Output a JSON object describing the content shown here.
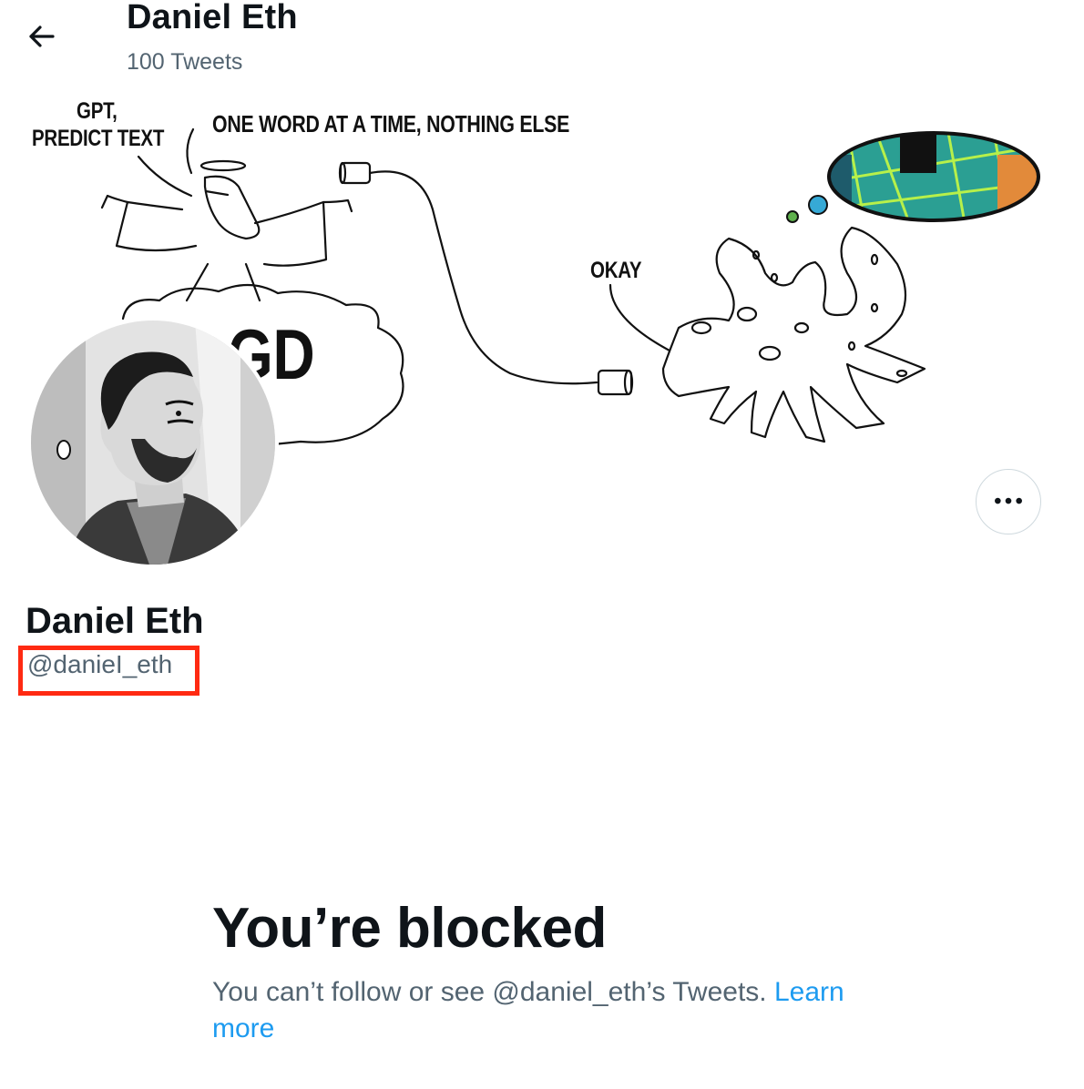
{
  "header": {
    "title": "Daniel Eth",
    "tweet_count": "100 Tweets"
  },
  "banner": {
    "text_gpt": "GPT,",
    "text_predict": "PREDICT TEXT",
    "text_oneword": "ONE WORD AT A TIME, NOTHING ELSE",
    "text_okay": "OKAY",
    "text_cloud": "GD"
  },
  "profile": {
    "name": "Daniel Eth",
    "handle": "@danieI_eth"
  },
  "blocked": {
    "title": "You’re blocked",
    "message": "You can’t follow or see @daniel_eth’s Tweets.",
    "learn_more": "Learn more"
  },
  "colors": {
    "text_primary": "#0f1419",
    "text_secondary": "#536471",
    "link": "#1d9bf0",
    "highlight_box": "#ff2a12"
  },
  "icons": {
    "back": "arrow-left-icon",
    "more": "more-horizontal-icon"
  }
}
